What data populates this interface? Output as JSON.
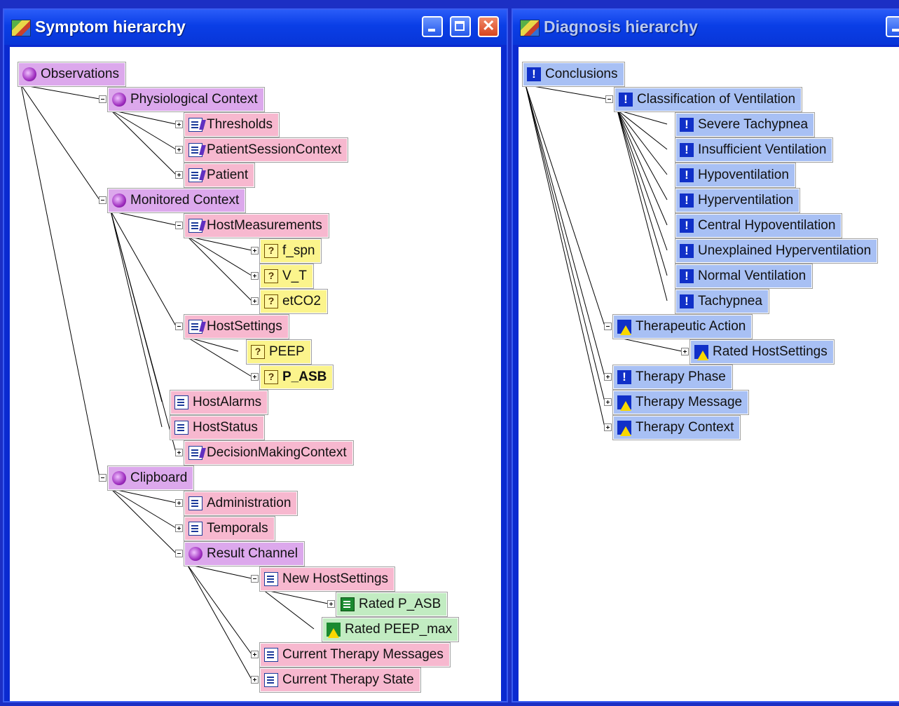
{
  "left_window": {
    "title": "Symptom hierarchy",
    "buttons": {
      "minimize": "minimize",
      "maximize": "maximize",
      "close": "close"
    },
    "nodes": [
      {
        "label": "Observations",
        "icon": "ontology-icon",
        "color": "purple"
      },
      {
        "label": "Physiological Context",
        "icon": "ontology-icon",
        "color": "purple",
        "expander": "minus"
      },
      {
        "label": "Thresholds",
        "icon": "document-select-icon",
        "color": "pink",
        "expander": "plus"
      },
      {
        "label": "PatientSessionContext",
        "icon": "document-select-icon",
        "color": "pink",
        "expander": "plus"
      },
      {
        "label": "Patient",
        "icon": "document-select-icon",
        "color": "pink",
        "expander": "plus"
      },
      {
        "label": "Monitored Context",
        "icon": "ontology-icon",
        "color": "purple",
        "expander": "minus"
      },
      {
        "label": "HostMeasurements",
        "icon": "document-select-icon",
        "color": "pink",
        "expander": "minus"
      },
      {
        "label": "f_spn",
        "icon": "query-icon",
        "color": "yellow",
        "expander": "plus"
      },
      {
        "label": "V_T",
        "icon": "query-icon",
        "color": "yellow",
        "expander": "plus"
      },
      {
        "label": "etCO2",
        "icon": "query-icon",
        "color": "yellow",
        "expander": "plus"
      },
      {
        "label": "HostSettings",
        "icon": "document-select-icon",
        "color": "pink",
        "expander": "minus"
      },
      {
        "label": "PEEP",
        "icon": "query-icon",
        "color": "yellow"
      },
      {
        "label": "P_ASB",
        "icon": "query-icon",
        "color": "yellow",
        "expander": "plus",
        "bold": true
      },
      {
        "label": "HostAlarms",
        "icon": "document-icon",
        "color": "pink"
      },
      {
        "label": "HostStatus",
        "icon": "document-icon",
        "color": "pink"
      },
      {
        "label": "DecisionMakingContext",
        "icon": "document-select-icon",
        "color": "pink",
        "expander": "plus"
      },
      {
        "label": "Clipboard",
        "icon": "ontology-icon",
        "color": "purple",
        "expander": "minus"
      },
      {
        "label": "Administration",
        "icon": "document-icon",
        "color": "pink",
        "expander": "plus"
      },
      {
        "label": "Temporals",
        "icon": "document-icon",
        "color": "pink",
        "expander": "plus"
      },
      {
        "label": "Result Channel",
        "icon": "ontology-icon",
        "color": "purple",
        "expander": "minus"
      },
      {
        "label": "New HostSettings",
        "icon": "document-icon",
        "color": "pink",
        "expander": "minus"
      },
      {
        "label": "Rated P_ASB",
        "icon": "green-document-icon",
        "color": "green",
        "expander": "plus"
      },
      {
        "label": "Rated PEEP_max",
        "icon": "green-warning-icon",
        "color": "green"
      },
      {
        "label": "Current Therapy Messages",
        "icon": "document-icon",
        "color": "pink",
        "expander": "plus"
      },
      {
        "label": "Current Therapy State",
        "icon": "document-icon",
        "color": "pink",
        "expander": "plus"
      }
    ]
  },
  "right_window": {
    "title": "Diagnosis hierarchy",
    "buttons": {
      "minimize": "minimize"
    },
    "nodes": [
      {
        "label": "Conclusions",
        "icon": "exclamation-icon",
        "color": "blue"
      },
      {
        "label": "Classification of Ventilation",
        "icon": "exclamation-icon",
        "color": "blue",
        "expander": "minus"
      },
      {
        "label": "Severe Tachypnea",
        "icon": "exclamation-icon",
        "color": "blue"
      },
      {
        "label": "Insufficient Ventilation",
        "icon": "exclamation-icon",
        "color": "blue"
      },
      {
        "label": "Hypoventilation",
        "icon": "exclamation-icon",
        "color": "blue"
      },
      {
        "label": "Hyperventilation",
        "icon": "exclamation-icon",
        "color": "blue"
      },
      {
        "label": "Central Hypoventilation",
        "icon": "exclamation-icon",
        "color": "blue"
      },
      {
        "label": "Unexplained Hyperventilation",
        "icon": "exclamation-icon",
        "color": "blue"
      },
      {
        "label": "Normal Ventilation",
        "icon": "exclamation-icon",
        "color": "blue"
      },
      {
        "label": "Tachypnea",
        "icon": "exclamation-icon",
        "color": "blue"
      },
      {
        "label": "Therapeutic Action",
        "icon": "warning-icon",
        "color": "blue",
        "expander": "minus"
      },
      {
        "label": "Rated HostSettings",
        "icon": "warning-icon",
        "color": "blue",
        "expander": "plus"
      },
      {
        "label": "Therapy Phase",
        "icon": "exclamation-icon",
        "color": "blue",
        "expander": "plus"
      },
      {
        "label": "Therapy Message",
        "icon": "warning-icon",
        "color": "blue",
        "expander": "plus"
      },
      {
        "label": "Therapy Context",
        "icon": "warning-icon",
        "color": "blue",
        "expander": "plus"
      }
    ]
  },
  "colors": {
    "desktop": "#1c2fc4",
    "purple": "#dca8ec",
    "pink": "#f7b8cf",
    "yellow": "#fbf48c",
    "green": "#c2ecc2",
    "blue": "#a8c0f4"
  }
}
